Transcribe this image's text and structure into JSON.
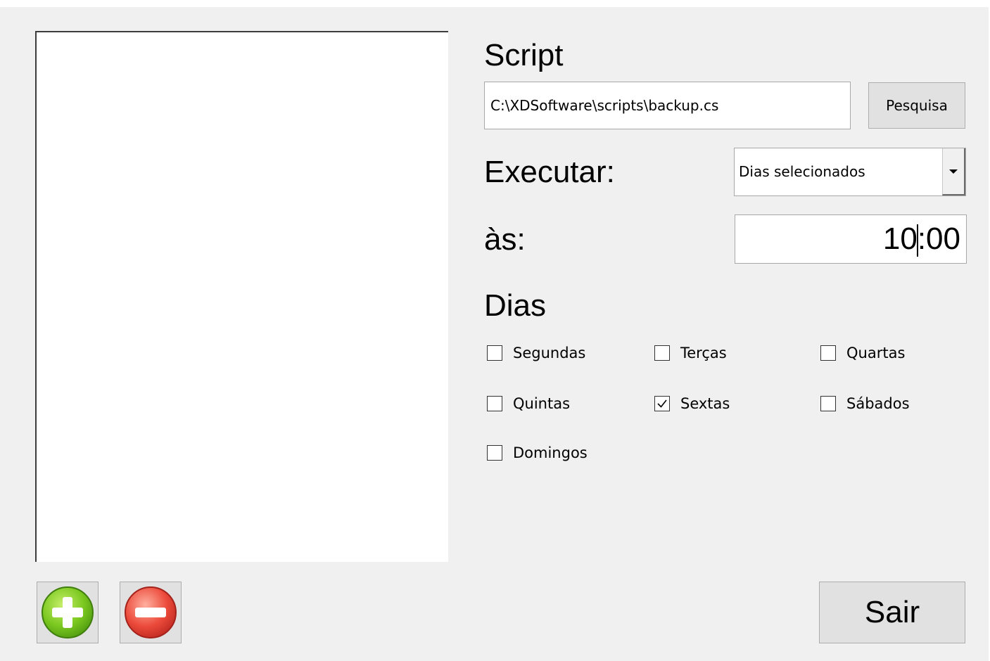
{
  "script": {
    "label": "Script",
    "path_value": "C:\\XDSoftware\\scripts\\backup.cs",
    "browse_label": "Pesquisa"
  },
  "execute": {
    "label": "Executar:",
    "selected_option": "Dias selecionados"
  },
  "time": {
    "label": "às:",
    "value_before_caret": "10",
    "value_after_caret": ":00"
  },
  "days": {
    "label": "Dias",
    "items": [
      {
        "label": "Segundas",
        "checked": false
      },
      {
        "label": "Terças",
        "checked": false
      },
      {
        "label": "Quartas",
        "checked": false
      },
      {
        "label": "Quintas",
        "checked": false
      },
      {
        "label": "Sextas",
        "checked": true
      },
      {
        "label": "Sábados",
        "checked": false
      },
      {
        "label": "Domingos",
        "checked": false
      }
    ]
  },
  "footer": {
    "exit_label": "Sair",
    "add_icon": "add-circle-icon",
    "remove_icon": "remove-circle-icon"
  },
  "colors": {
    "add": "#6cc11f",
    "remove": "#e8453c",
    "window_bg": "#f0f0f0"
  }
}
